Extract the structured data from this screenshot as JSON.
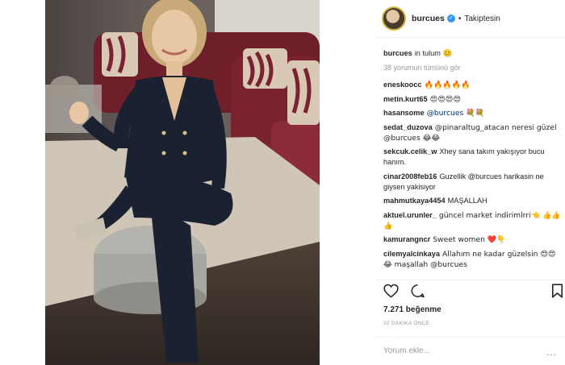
{
  "header": {
    "username": "burcues",
    "verified_mark": "✓",
    "follow_status": "Takiptesin"
  },
  "caption": {
    "user": "burcues",
    "text": "in tulum 😊"
  },
  "view_all": "38 yorumun tümünü gör",
  "comments": [
    {
      "user": "eneskoocc",
      "text": "🔥🔥🔥🔥🔥"
    },
    {
      "user": "metin.kurt65",
      "text": "😍😍😍😍"
    },
    {
      "user": "hasansome",
      "text": "@burcues 💐💐"
    },
    {
      "user": "sedat_duzova",
      "text": "@pinaraltug_atacan neresi güzel @burcues 😂😂"
    },
    {
      "user": "sekcuk.celik_w",
      "text": "Xhey sana takım yakışıyor bucu hanım."
    },
    {
      "user": "cinar2008feb16",
      "text": "Guzellik @burcues harikasin ne giysen yakisiyor"
    },
    {
      "user": "mahmutkaya4454",
      "text": "MAŞALLAH"
    },
    {
      "user": "aktuel.urunler_",
      "text": "güncel market indirimlrri👈 👍👍👍"
    },
    {
      "user": "kamurangncr",
      "text": "Sweet women ❤️👇"
    },
    {
      "user": "cilemyalcinkaya",
      "text": "Allahım ne kadar güzelsin 😍😍😂 maşallah @burcues"
    }
  ],
  "likes": "7.271 beğenme",
  "timestamp": "32 DAKİKA ÖNCE",
  "add_comment_placeholder": "Yorum ekle...",
  "more_options": "…",
  "icons": [
    "heart-icon",
    "comment-icon",
    "bookmark-icon",
    "verified-badge-icon",
    "more-options-icon"
  ],
  "colors": {
    "mention": "#003569",
    "verified": "#3897f0",
    "muted": "#999999",
    "divider": "#efefef"
  }
}
